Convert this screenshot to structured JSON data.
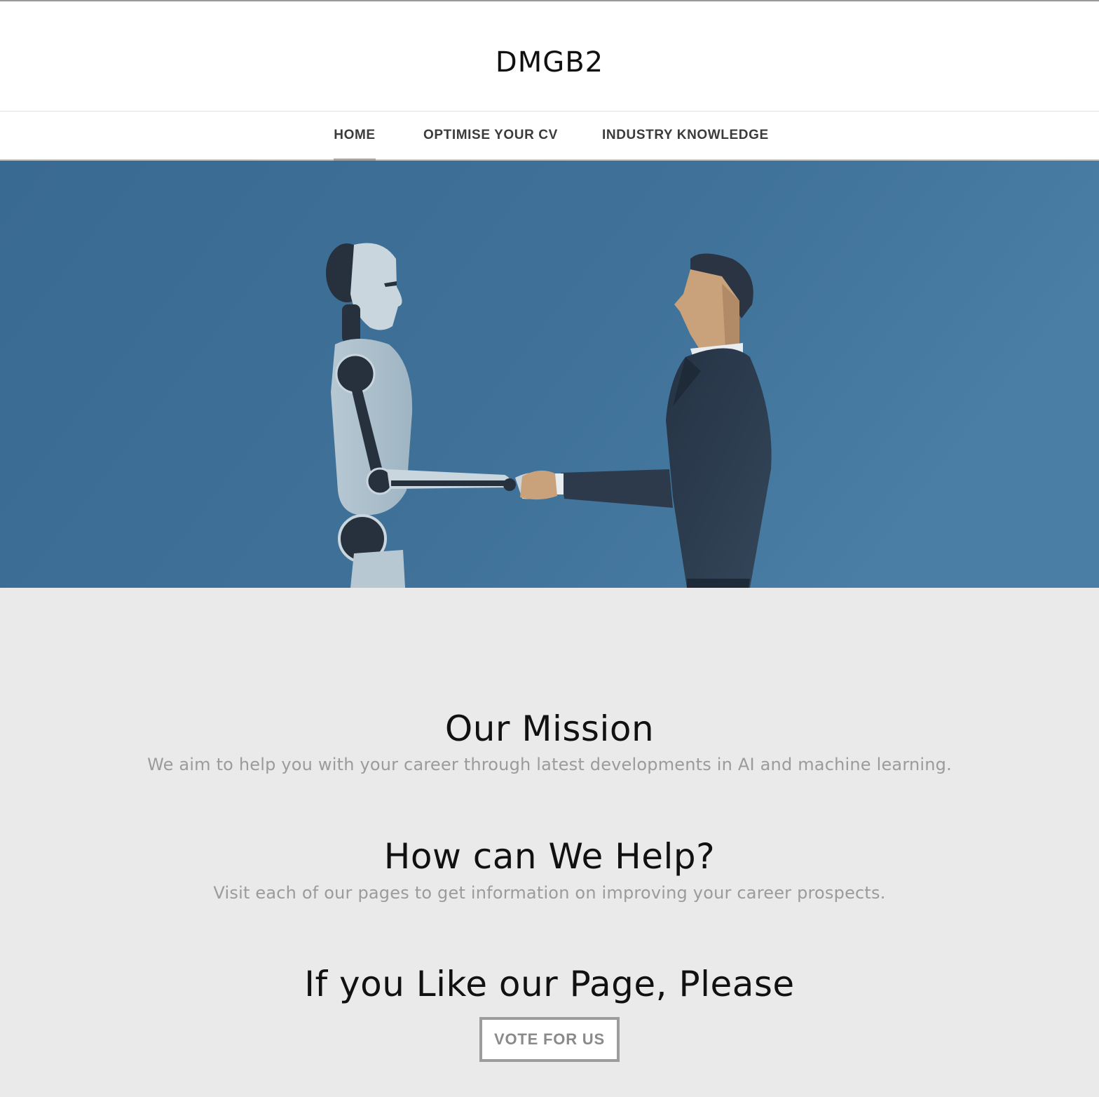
{
  "header": {
    "title": "DMGB2"
  },
  "nav": {
    "items": [
      {
        "label": "HOME",
        "active": true
      },
      {
        "label": "OPTIMISE YOUR CV",
        "active": false
      },
      {
        "label": "INDUSTRY KNOWLEDGE",
        "active": false
      }
    ]
  },
  "hero": {
    "image": "robot-handshake-businessman-illustration",
    "background_color": "#3f7199"
  },
  "sections": {
    "mission": {
      "heading": "Our Mission",
      "text": "We aim to help you with your career through latest developments in AI and machine learning."
    },
    "help": {
      "heading": "How can We Help?",
      "text": "Visit each of our pages to get information on improving your career prospects."
    },
    "like": {
      "heading": "If you Like our Page, Please",
      "button_label": "VOTE FOR US"
    }
  },
  "colors": {
    "page_background": "#eaeaea",
    "nav_active_underline": "#a5a5a5",
    "muted_text": "#9b9b9b"
  }
}
